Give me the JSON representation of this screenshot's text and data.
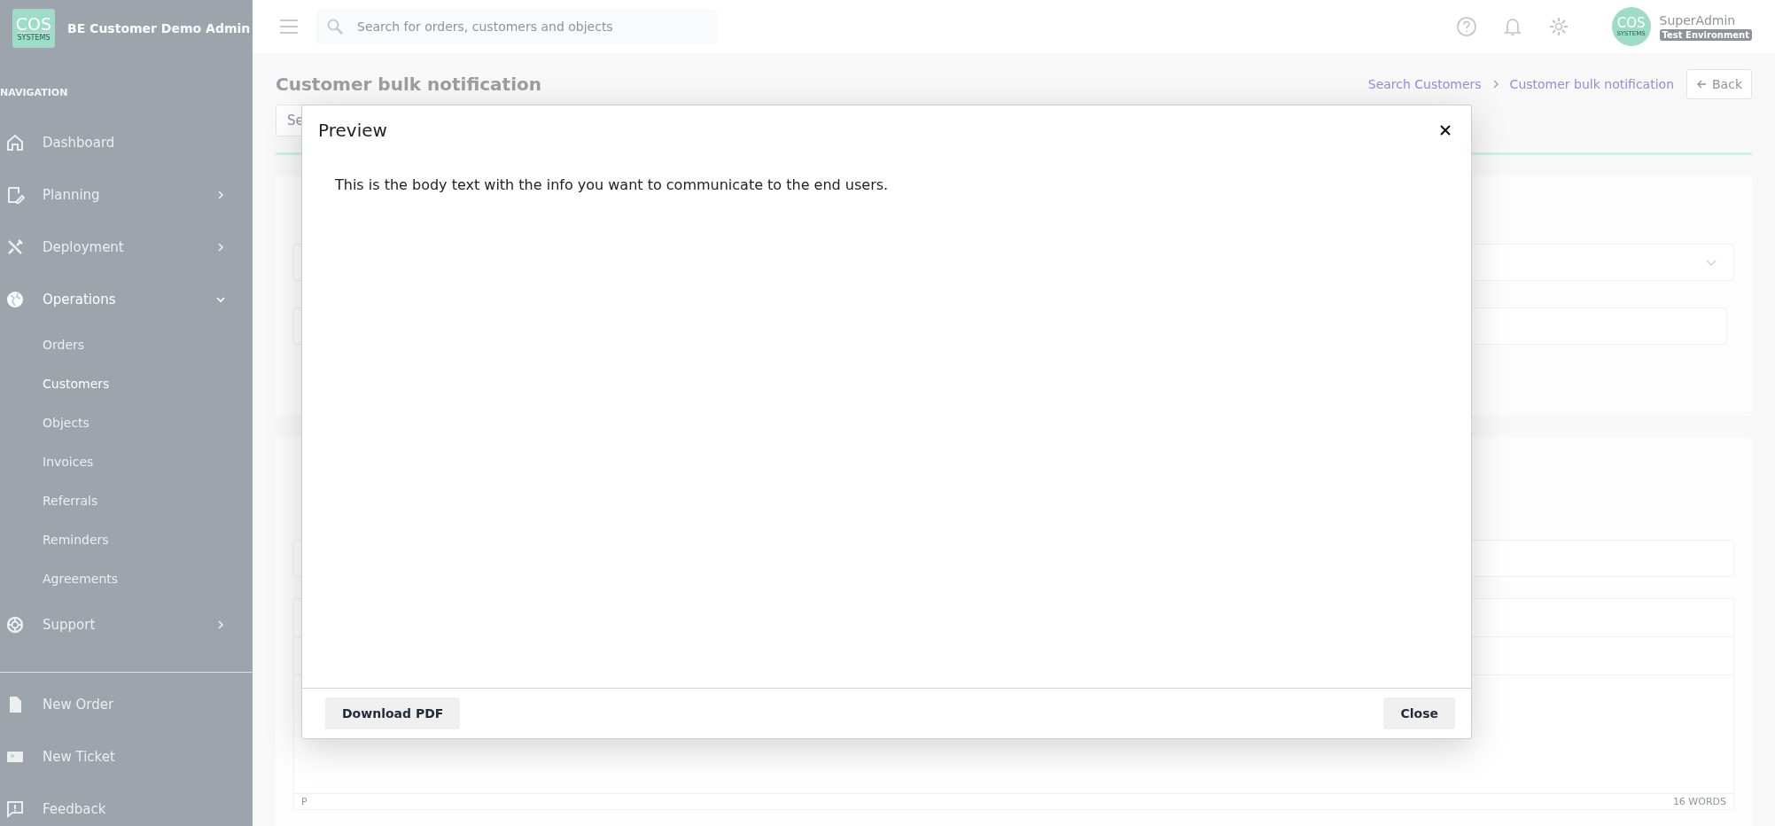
{
  "sidebar": {
    "brand": {
      "logo_text": "COS",
      "logo_subtext": "SYSTEMS",
      "title": "BE Customer Demo Admin"
    },
    "section_label": "NAVIGATION",
    "items": [
      {
        "label": "Dashboard",
        "selected": false
      },
      {
        "label": "Planning",
        "selected": false,
        "expanded": false
      },
      {
        "label": "Deployment",
        "selected": false,
        "expanded": false
      },
      {
        "label": "Operations",
        "selected": true,
        "expanded": true,
        "children": [
          {
            "label": "Orders",
            "selected": false
          },
          {
            "label": "Customers",
            "selected": true
          },
          {
            "label": "Objects",
            "selected": false
          },
          {
            "label": "Invoices",
            "selected": false
          },
          {
            "label": "Referrals",
            "selected": false
          },
          {
            "label": "Reminders",
            "selected": false
          },
          {
            "label": "Agreements",
            "selected": false
          }
        ]
      },
      {
        "label": "Support",
        "selected": false,
        "expanded": false
      }
    ],
    "footer_items": [
      {
        "label": "New Order"
      },
      {
        "label": "New Ticket"
      },
      {
        "label": "Feedback"
      }
    ]
  },
  "header": {
    "search": {
      "placeholder": "Search for orders, customers and objects"
    },
    "avatar": {
      "logo_text": "COS",
      "logo_subtext": "SYSTEMS"
    },
    "user_name": "SuperAdmin",
    "environment_badge": "Test Environment"
  },
  "page": {
    "title": "Customer bulk notification",
    "breadcrumbs": [
      {
        "label": "Search Customers"
      },
      {
        "label": "Customer bulk notification"
      }
    ],
    "back_button": "Back",
    "filter_field": {
      "placeholder": "Se"
    },
    "editor": {
      "status_path": "P",
      "word_count": "16 WORDS"
    }
  },
  "modal": {
    "title": "Preview",
    "body": "This is the body text with the info you want to communicate to the end users.",
    "buttons": {
      "download": "Download PDF",
      "close": "Close"
    }
  }
}
